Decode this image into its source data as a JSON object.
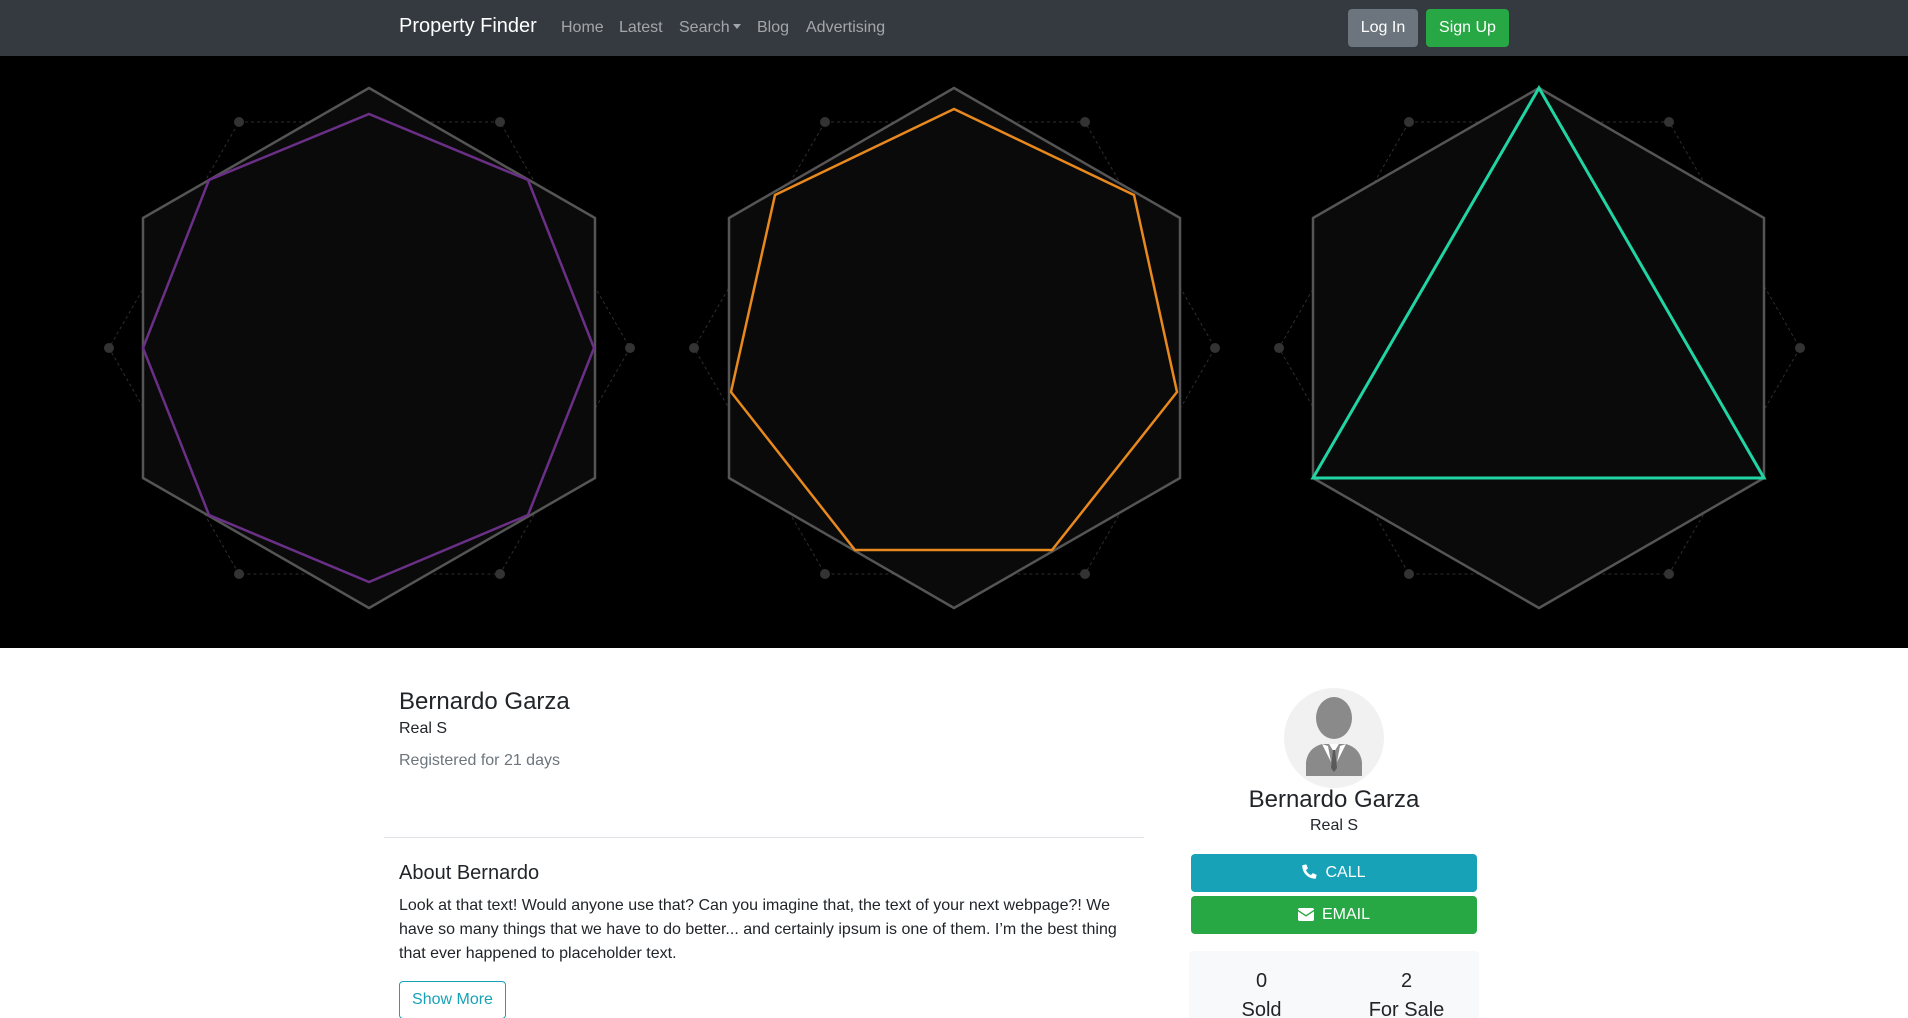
{
  "navbar": {
    "brand": "Property Finder",
    "links": [
      "Home",
      "Latest",
      "Search",
      "Blog",
      "Advertising"
    ],
    "login_label": "Log In",
    "signup_label": "Sign Up"
  },
  "hero": {
    "background": "#000000",
    "shape_colors": [
      "#6a2f86",
      "#e8891d",
      "#20d5a3"
    ],
    "outline_color": "#555555"
  },
  "profile": {
    "name": "Bernardo Garza",
    "title": "Real S",
    "registered": "Registered for 21 days",
    "about_heading": "About Bernardo",
    "about_text": "Look at that text! Would anyone use that? Can you imagine that, the text of your next webpage?! We have so many things that we have to do better... and certainly ipsum is one of them. I’m the best thing that ever happened to placeholder text.",
    "show_more_label": "Show More"
  },
  "card": {
    "name": "Bernardo Garza",
    "title": "Real S",
    "call_label": "CALL",
    "email_label": "EMAIL",
    "stats": [
      {
        "value": "0",
        "label": "Sold"
      },
      {
        "value": "2",
        "label": "For Sale"
      }
    ]
  }
}
